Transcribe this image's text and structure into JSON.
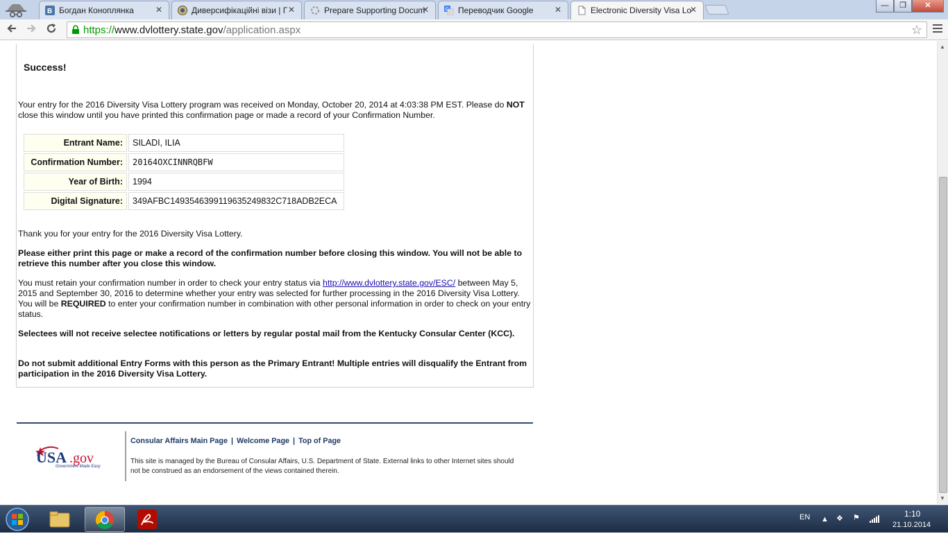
{
  "browser": {
    "tabs": [
      {
        "title": "Богдан Коноплянка",
        "icon": "vk-icon",
        "active": false
      },
      {
        "title": "Диверсифікаційні візи | Г",
        "icon": "embassy-seal-icon",
        "active": false
      },
      {
        "title": "Prepare Supporting Docum",
        "icon": "loading-icon",
        "active": false
      },
      {
        "title": "Переводчик Google",
        "icon": "google-translate-icon",
        "active": false
      },
      {
        "title": "Electronic Diversity Visa Lo",
        "icon": "page-icon",
        "active": true
      }
    ],
    "url": {
      "scheme": "https://",
      "host": "www.dvlottery.state.gov",
      "path": "/application.aspx"
    }
  },
  "page": {
    "success_heading": "Success!",
    "intro_part1": "Your entry for the 2016 Diversity Visa Lottery program was received on Monday, October 20, 2014 at 4:03:38 PM EST. Please do ",
    "intro_bold": "NOT",
    "intro_part2": " close this window until you have printed this confirmation page or made a record of your Confirmation Number.",
    "entrant": [
      {
        "label": "Entrant Name:",
        "value": "SILADI, ILIA"
      },
      {
        "label": "Confirmation Number:",
        "value": "20164OXCINNRQBFW"
      },
      {
        "label": "Year of Birth:",
        "value": "1994"
      },
      {
        "label": "Digital Signature:",
        "value": "349AFBC149354639911963524983​2C718ADB2ECA"
      }
    ],
    "thank_you": "Thank you for your entry for the 2016 Diversity Visa Lottery.",
    "print_warning": "Please either print this page or make a record of the confirmation number before closing this window. You will not be able to retrieve this number after you close this window.",
    "retain_part1": "You must retain your confirmation number in order to check your entry status via ",
    "retain_link": "http://www.dvlottery.state.gov/ESC/",
    "retain_part2": " between May 5, 2015 and September 30, 2016 to determine whether your entry was selected for further processing in the 2016 Diversity Visa Lottery. You will be ",
    "retain_bold": "REQUIRED",
    "retain_part3": " to enter your confirmation number in combination with other personal information in order to check on your entry status.",
    "selectees_notice": "Selectees will not receive selectee notifications or letters by regular postal mail from the Kentucky Consular Center (KCC).",
    "duplicate_warning": "Do not submit additional Entry Forms with this person as the Primary Entrant!  Multiple entries will disqualify the Entrant from participation in the 2016 Diversity Visa Lottery."
  },
  "footer": {
    "logo_main": "USA.gov",
    "logo_tagline": "Government Made Easy",
    "links": [
      "Consular Affairs Main Page",
      "Welcome Page",
      "Top of Page"
    ],
    "separator": "|",
    "note": "This site is managed by the Bureau of Consular Affairs, U.S. Department of State. External links to other Internet sites should not be construed as an endorsement of the views contained therein."
  },
  "taskbar": {
    "language": "EN",
    "time": "1:10",
    "date": "21.10.2014"
  },
  "colors": {
    "link": "#1a0dab",
    "label_bg": "#fffff0",
    "footer_rule": "#2f4a6e",
    "https_green": "#009a00"
  }
}
